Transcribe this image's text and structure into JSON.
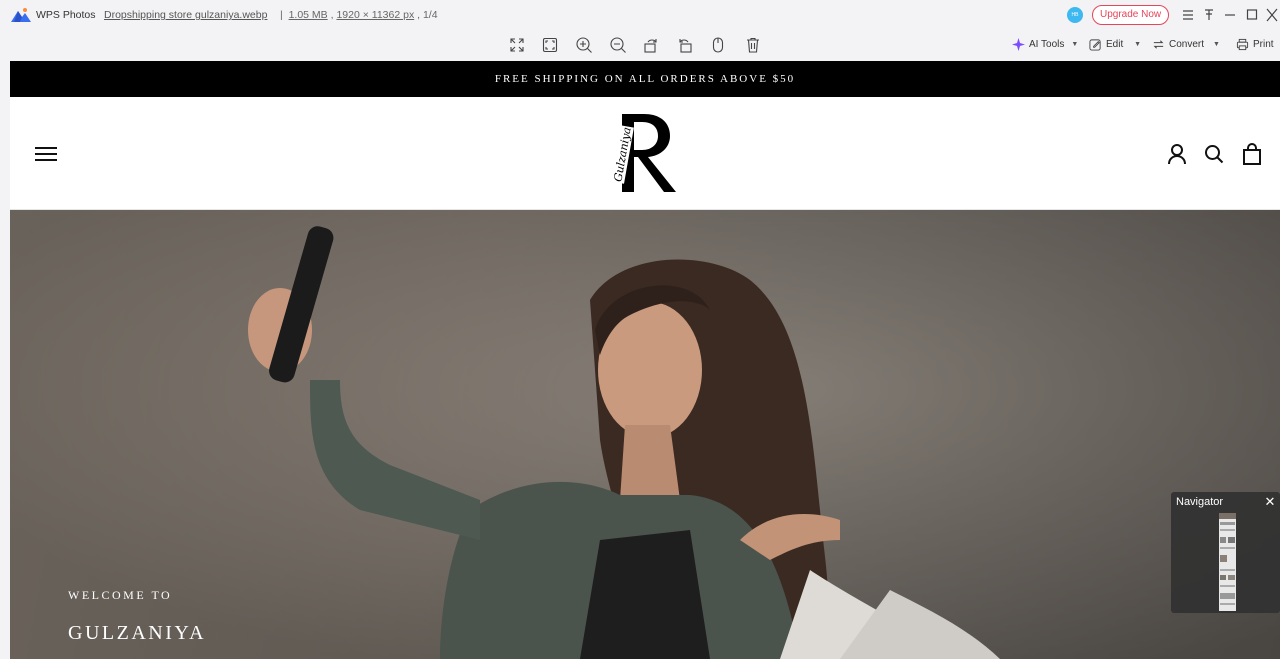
{
  "titlebar": {
    "app_name": "WPS Photos",
    "file_name": "Dropshipping store gulzaniya.webp",
    "file_size": "1.05 MB",
    "dimensions": "1920 × 11362 px",
    "page_index": "1/4",
    "avatar_text": "HB",
    "upgrade_label": "Upgrade Now"
  },
  "toolbar": {
    "ai_tools_label": "AI Tools",
    "edit_label": "Edit",
    "convert_label": "Convert",
    "print_label": "Print"
  },
  "page": {
    "announcement": "FREE SHIPPING ON ALL ORDERS ABOVE $50",
    "logo_letter": "R",
    "logo_script": "Gulzaniya",
    "hero_welcome": "WELCOME TO",
    "hero_title": "GULZANIYA"
  },
  "navigator": {
    "title": "Navigator",
    "close": "✕"
  },
  "colors": {
    "upgrade_accent": "#e6455a",
    "announcement_bg": "#000000",
    "ai_tools_accent": "#7b4dff"
  },
  "icons": [
    "expand-icon",
    "fit-screen-icon",
    "zoom-in-icon",
    "zoom-out-icon",
    "rotate-left-icon",
    "rotate-right-icon",
    "mouse-icon",
    "delete-icon",
    "menu-icon",
    "account-icon",
    "search-icon",
    "bag-icon"
  ]
}
